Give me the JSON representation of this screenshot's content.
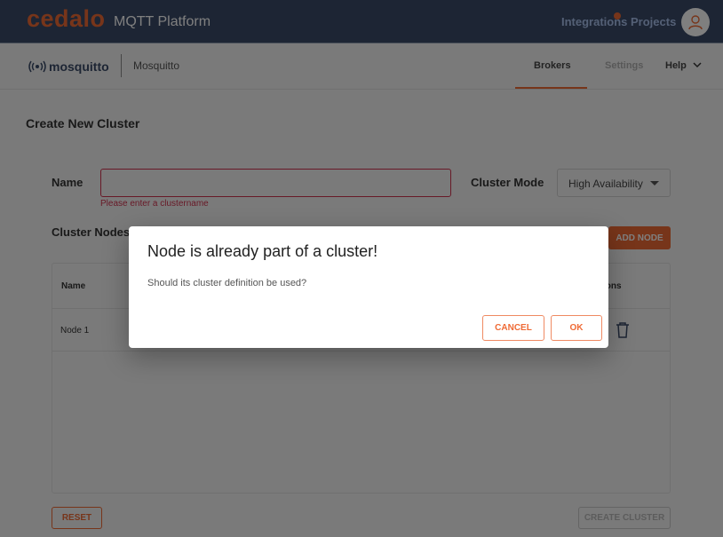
{
  "header": {
    "brand": "cedalo",
    "platform": "MQTT Platform",
    "integrations_label": "Integrations",
    "projects_label": "Projects"
  },
  "subnav": {
    "logo_text": "mosquitto",
    "product_name": "Mosquitto",
    "tabs": [
      {
        "label": "Brokers",
        "active": true
      },
      {
        "label": "Settings",
        "active": false
      },
      {
        "label": "Help",
        "active": false
      }
    ]
  },
  "page": {
    "title": "Create New Cluster",
    "name_label": "Name",
    "name_value": "",
    "name_error": "Please enter a clustername",
    "mode_label": "Cluster Mode",
    "mode_value": "High Availability",
    "nodes_label": "Cluster Nodes",
    "add_node_label": "ADD NODE",
    "table": {
      "columns": [
        "Name",
        "ions"
      ],
      "rows": [
        {
          "name": "Node 1"
        }
      ]
    },
    "reset_label": "RESET",
    "create_label": "CREATE CLUSTER"
  },
  "dialog": {
    "title": "Node is already part of a cluster!",
    "message": "Should its cluster definition be used?",
    "cancel_label": "CANCEL",
    "ok_label": "OK"
  },
  "colors": {
    "accent": "#ef6a35",
    "header_bg": "#3b4b68",
    "error": "#d0324f"
  }
}
